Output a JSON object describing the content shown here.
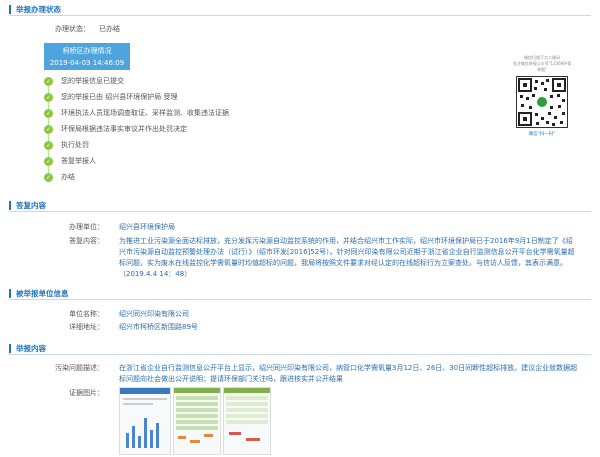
{
  "status_section": {
    "title": "举报办理状态",
    "status_label": "办理状态：",
    "status_value": "已办结",
    "box_line1": "柯桥区办理情况",
    "box_line2": "2019-04-03 14:46:09",
    "steps": [
      "您的举报信息已提交",
      "您的举报已由 绍兴县环境保护局 受理",
      "环境执法人员现场调查取证、采样监测、收集违法证据",
      "环保局根据违法事实审议并作出处罚决定",
      "执行处罚",
      "答复举报人",
      "办结"
    ],
    "qr_caption1": "微信扫描下方二维码",
    "qr_caption2": "关注微信举报公众号\"12369环保举报\"",
    "qr_bottom": "微信\"扫一扫\""
  },
  "reply_section": {
    "title": "答复内容",
    "unit_label": "办理单位：",
    "unit_value": "绍兴县环境保护局",
    "content_label": "答复内容：",
    "content_value": "为推进工业污染源全面达标排放，充分发挥污染源自动监控系统的作用，并结合绍兴市工作实际，绍兴市环境保护局已于2016年9月1日制定了《绍兴市污染源自动监控预警处理办法（试行）》（绍市环发[2016]52号）。针对同兴印染有限公司近期于浙江省企业自行监测信息公开平台化学需氧量超标问题，实为废水在线监控化学需氧量时均值超标的问题，我局将按照文件要求对经认定的在线超标行为立案查处。与信访人反馈，其表示满意。（2019.4.4 14：48）"
  },
  "reported_section": {
    "title": "被举报单位信息",
    "name_label": "单位名称：",
    "name_value": "绍兴同兴印染有限公司",
    "address_label": "详细地址：",
    "address_value": "绍兴市柯桥区新围路89号"
  },
  "complaint_section": {
    "title": "举报内容",
    "desc_label": "污染问题描述：",
    "desc_value": "在浙江省企业自行监测信息公开平台上显示，绍兴同兴印染有限公司，纳管口化学需氧量3月12日、26日、30日间断性超标排放。建议企业就数据超标问题向社会做出公开说明；提请环保部门关注吗，跟进核实并公开结果",
    "images_label": "证据图片："
  }
}
